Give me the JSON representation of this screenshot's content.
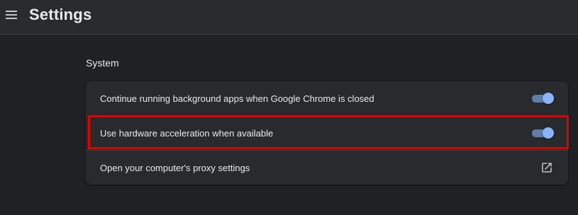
{
  "header": {
    "menu_icon": "hamburger-menu-icon",
    "title": "Settings"
  },
  "system": {
    "section_title": "System",
    "items": [
      {
        "label": "Continue running background apps when Google Chrome is closed",
        "control": "toggle",
        "enabled": true
      },
      {
        "label": "Use hardware acceleration when available",
        "control": "toggle",
        "enabled": true,
        "highlighted": true
      },
      {
        "label": "Open your computer's proxy settings",
        "control": "external-link-icon"
      }
    ]
  },
  "colors": {
    "background": "#202124",
    "card": "#292a2d",
    "toggle_on": "#8ab4f8",
    "highlight_box": "#e00000"
  }
}
